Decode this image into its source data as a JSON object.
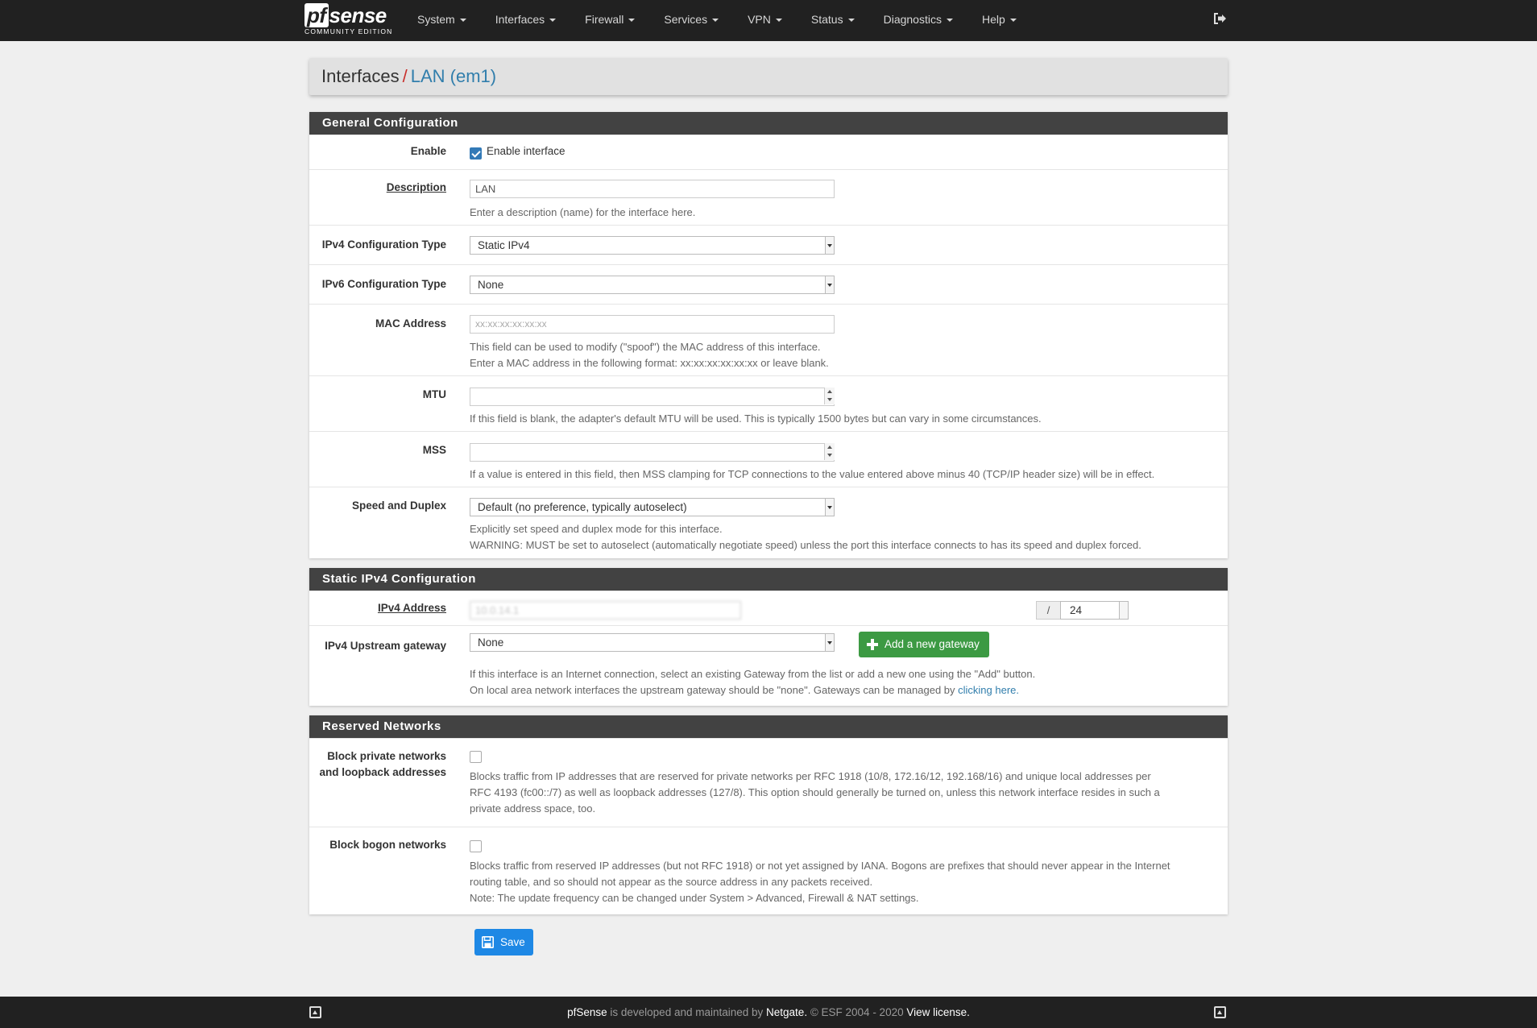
{
  "navbar": {
    "brand": {
      "logo_pf": "pf",
      "logo_rest": "sense",
      "edition": "COMMUNITY EDITION"
    },
    "menu": [
      "System",
      "Interfaces",
      "Firewall",
      "Services",
      "VPN",
      "Status",
      "Diagnostics",
      "Help"
    ]
  },
  "breadcrumb": {
    "section": "Interfaces",
    "separator": "/",
    "current": "LAN (em1)"
  },
  "general": {
    "heading": "General Configuration",
    "enable": {
      "label": "Enable",
      "checkbox_label": "Enable interface",
      "checked": true
    },
    "description": {
      "label": "Description",
      "value": "LAN",
      "help": "Enter a description (name) for the interface here."
    },
    "ipv4_type": {
      "label": "IPv4 Configuration Type",
      "value": "Static IPv4"
    },
    "ipv6_type": {
      "label": "IPv6 Configuration Type",
      "value": "None"
    },
    "mac": {
      "label": "MAC Address",
      "placeholder": "xx:xx:xx:xx:xx:xx",
      "help1": "This field can be used to modify (\"spoof\") the MAC address of this interface.",
      "help2": "Enter a MAC address in the following format: xx:xx:xx:xx:xx:xx or leave blank."
    },
    "mtu": {
      "label": "MTU",
      "value": "",
      "help": "If this field is blank, the adapter's default MTU will be used. This is typically 1500 bytes but can vary in some circumstances."
    },
    "mss": {
      "label": "MSS",
      "value": "",
      "help": "If a value is entered in this field, then MSS clamping for TCP connections to the value entered above minus 40 (TCP/IP header size) will be in effect."
    },
    "speed": {
      "label": "Speed and Duplex",
      "value": "Default (no preference, typically autoselect)",
      "help1": "Explicitly set speed and duplex mode for this interface.",
      "help2": "WARNING: MUST be set to autoselect (automatically negotiate speed) unless the port this interface connects to has its speed and duplex forced."
    }
  },
  "static_ipv4": {
    "heading": "Static IPv4 Configuration",
    "address": {
      "label": "IPv4 Address",
      "value": "10.0.14.1",
      "slash": "/",
      "mask": "24"
    },
    "gateway": {
      "label": "IPv4 Upstream gateway",
      "value": "None",
      "add_button": "Add a new gateway",
      "help1": "If this interface is an Internet connection, select an existing Gateway from the list or add a new one using the \"Add\" button.",
      "help2": "On local area network interfaces the upstream gateway should be \"none\". Gateways can be managed by ",
      "help_link": "clicking here."
    }
  },
  "reserved": {
    "heading": "Reserved Networks",
    "private": {
      "label1": "Block private networks",
      "label2": "and loopback addresses",
      "checked": false,
      "help1": "Blocks traffic from IP addresses that are reserved for private networks per RFC 1918 (10/8, 172.16/12, 192.168/16) and unique local addresses per",
      "help2": "RFC 4193 (fc00::/7) as well as loopback addresses (127/8). This option should generally be turned on, unless this network interface resides in such a",
      "help3": "private address space, too."
    },
    "bogon": {
      "label": "Block bogon networks",
      "checked": false,
      "help1": "Blocks traffic from reserved IP addresses (but not RFC 1918) or not yet assigned by IANA. Bogons are prefixes that should never appear in the Internet",
      "help2": "routing table, and so should not appear as the source address in any packets received.",
      "help3": "Note: The update frequency can be changed under System > Advanced, Firewall & NAT settings."
    }
  },
  "save_label": "Save",
  "footer": {
    "p1": "pfSense",
    "p2": " is developed and maintained by ",
    "p3": "Netgate.",
    "p4": " © ESF 2004 - 2020 ",
    "p5": "View license."
  },
  "colors": {
    "navbar": "#212121",
    "panel_heading": "#424242",
    "link": "#317eac",
    "accent_red": "#c9302c",
    "save": "#1e88e5",
    "add": "#3c9a43"
  }
}
